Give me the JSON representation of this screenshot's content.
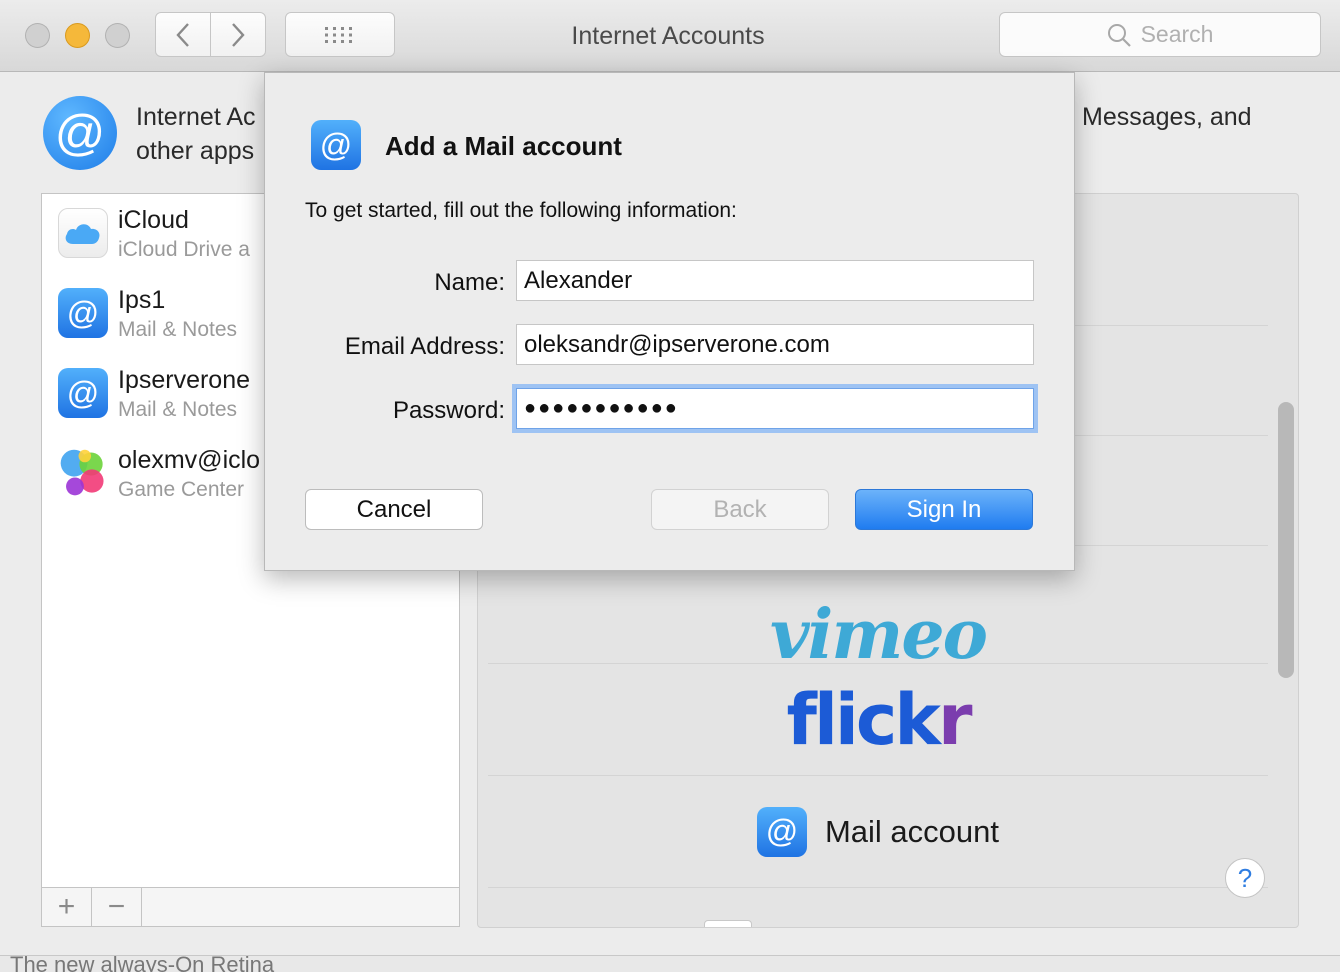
{
  "window": {
    "title": "Internet Accounts",
    "search_placeholder": "Search",
    "nav_back_icon": "‹",
    "nav_forward_icon": "›"
  },
  "header": {
    "line1_visible": "Internet Ac",
    "line1_right": "Messages, and",
    "line2_visible": "other apps"
  },
  "accounts": [
    {
      "name": "iCloud",
      "subtitle": "iCloud Drive a",
      "icon": "icloud-icon"
    },
    {
      "name": "Ips1",
      "subtitle": "Mail & Notes",
      "icon": "mail-icon"
    },
    {
      "name": "Ipserverone",
      "subtitle": "Mail & Notes",
      "icon": "mail-icon"
    },
    {
      "name": "olexmv@iclo",
      "subtitle": "Game Center",
      "icon": "game-center-icon"
    }
  ],
  "list_footer": {
    "add": "+",
    "remove": "−"
  },
  "providers": {
    "vimeo": "vimeo",
    "flickr_main": "flick",
    "flickr_r": "r",
    "mail": "Mail account"
  },
  "sheet": {
    "title": "Add a Mail account",
    "intro": "To get started, fill out the following information:",
    "name_label": "Name:",
    "name_value": "Alexander",
    "email_label": "Email Address:",
    "email_value": "oleksandr@ipserverone.com",
    "password_label": "Password:",
    "password_mask": "●●●●●●●●●●●",
    "cancel": "Cancel",
    "back": "Back",
    "sign_in": "Sign In"
  },
  "help": "?",
  "bottom_strip_text": "The new always-On Retina",
  "colors": {
    "accent": "#1f7cf0",
    "vimeo": "#3ea9d6",
    "flickr_blue": "#1c5bd6",
    "flickr_pink": "#7b3dae"
  }
}
